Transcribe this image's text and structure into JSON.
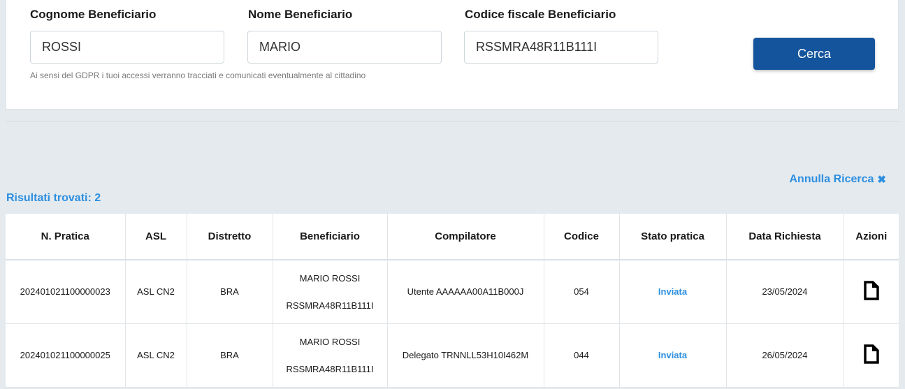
{
  "search": {
    "cognome_label": "Cognome Beneficiario",
    "cognome_value": "ROSSI",
    "nome_label": "Nome Beneficiario",
    "nome_value": "MARIO",
    "cf_label": "Codice fiscale Beneficiario",
    "cf_value": "RSSMRA48R11B111I",
    "gdpr_note": "Ai sensi del GDPR i tuoi accessi verranno tracciati e comunicati eventualmente al cittadino",
    "search_button": "Cerca"
  },
  "results": {
    "annulla_label": "Annulla Ricerca",
    "annulla_icon": "close-icon",
    "count_label": "Risultati trovati: 2",
    "columns": [
      "N. Pratica",
      "ASL",
      "Distretto",
      "Beneficiario",
      "Compilatore",
      "Codice",
      "Stato pratica",
      "Data Richiesta",
      "Azioni"
    ],
    "rows": [
      {
        "pratica": "202401021100000023",
        "asl": "ASL CN2",
        "distretto": "BRA",
        "beneficiario_nome": "MARIO ROSSI",
        "beneficiario_cf": "RSSMRA48R11B111I",
        "compilatore": "Utente AAAAAA00A11B000J",
        "codice": "054",
        "stato": "Inviata",
        "data": "23/05/2024",
        "azione_icon": "document-icon"
      },
      {
        "pratica": "202401021100000025",
        "asl": "ASL CN2",
        "distretto": "BRA",
        "beneficiario_nome": "MARIO ROSSI",
        "beneficiario_cf": "RSSMRA48R11B111I",
        "compilatore": "Delegato TRNNLL53H10I462M",
        "codice": "044",
        "stato": "Inviata",
        "data": "26/05/2024",
        "azione_icon": "document-icon"
      }
    ]
  },
  "colors": {
    "primary_button": "#14549c",
    "link_blue": "#2d8fe0",
    "page_background": "#e4eaee"
  }
}
